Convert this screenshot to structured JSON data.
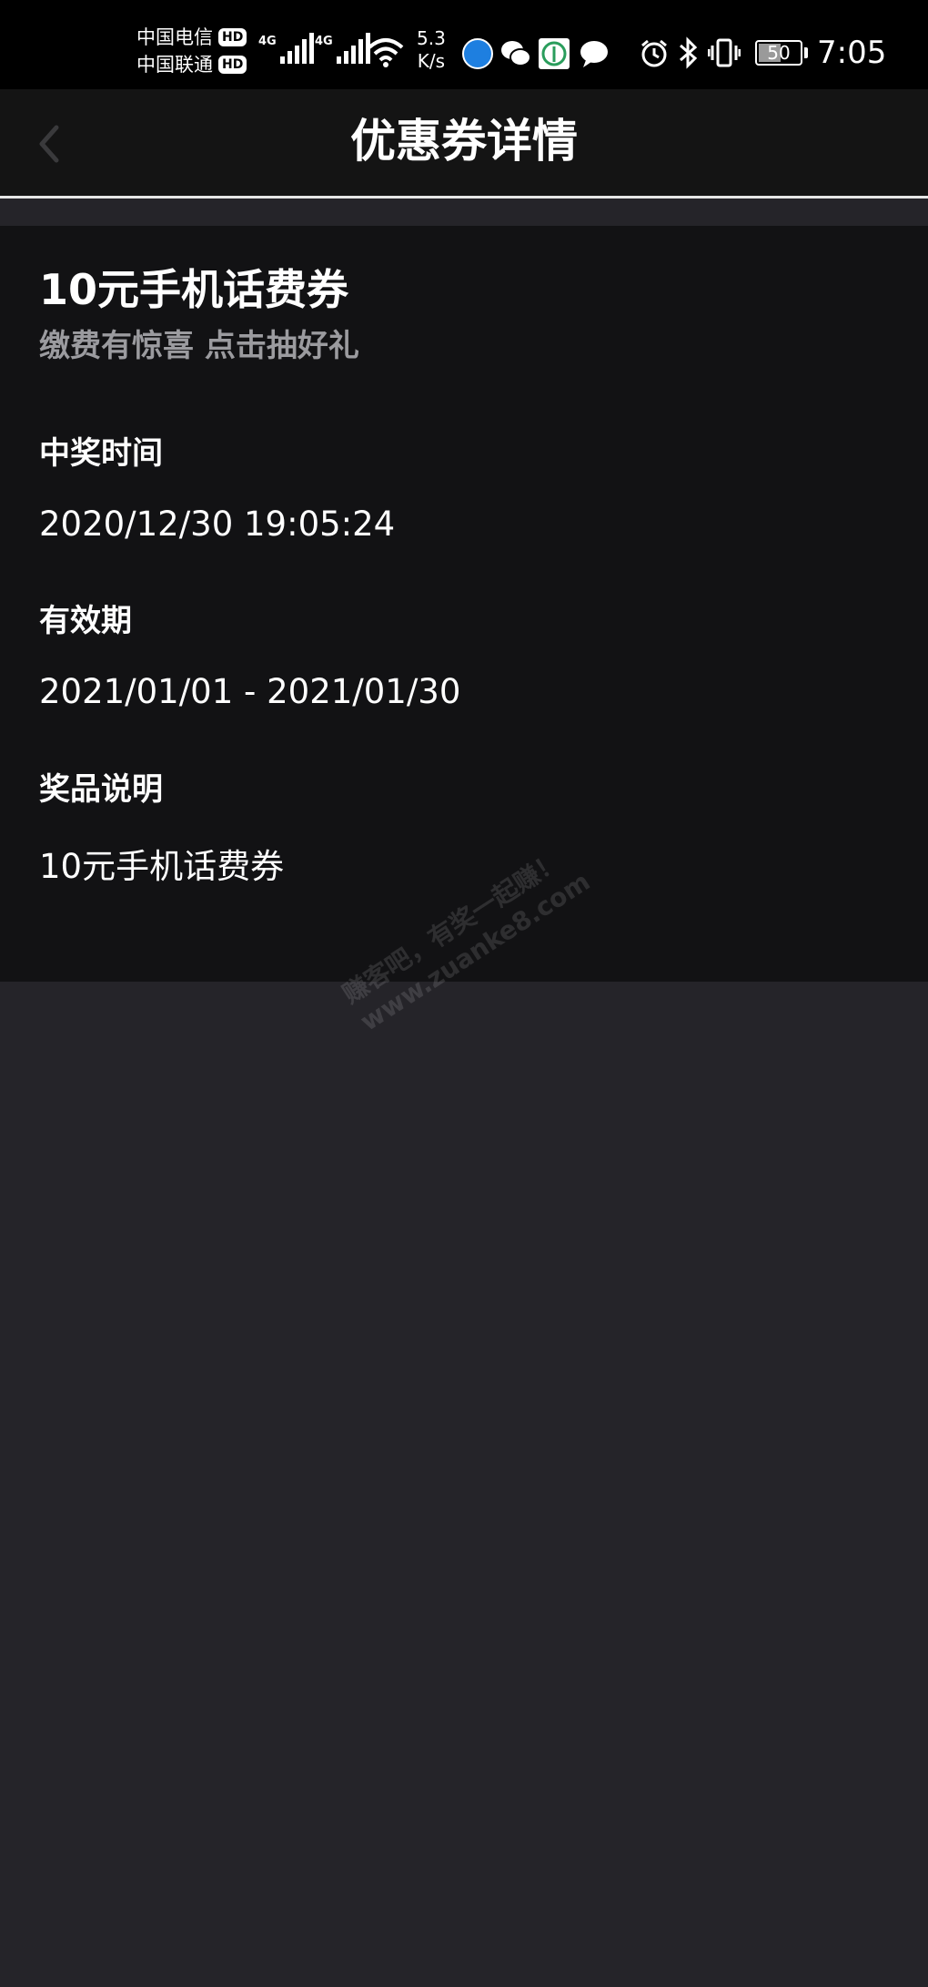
{
  "status_bar": {
    "carriers": [
      {
        "name": "中国电信",
        "badge": "HD"
      },
      {
        "name": "中国联通",
        "badge": "HD"
      }
    ],
    "network_labels": [
      "4G",
      "4G"
    ],
    "speed_value": "5.3",
    "speed_unit": "K/s",
    "battery_level": "50",
    "time": "7:05"
  },
  "nav": {
    "title": "优惠券详情"
  },
  "coupon": {
    "title": "10元手机话费券",
    "subtitle": "缴费有惊喜 点击抽好礼",
    "sections": [
      {
        "label": "中奖时间",
        "value": "2020/12/30 19:05:24"
      },
      {
        "label": "有效期",
        "value": "2021/01/01 - 2021/01/30"
      },
      {
        "label": "奖品说明",
        "value": "10元手机话费券"
      }
    ]
  },
  "watermark": {
    "line1": "赚客吧，有奖一起赚！",
    "line2": "www.zuanke8.com"
  }
}
